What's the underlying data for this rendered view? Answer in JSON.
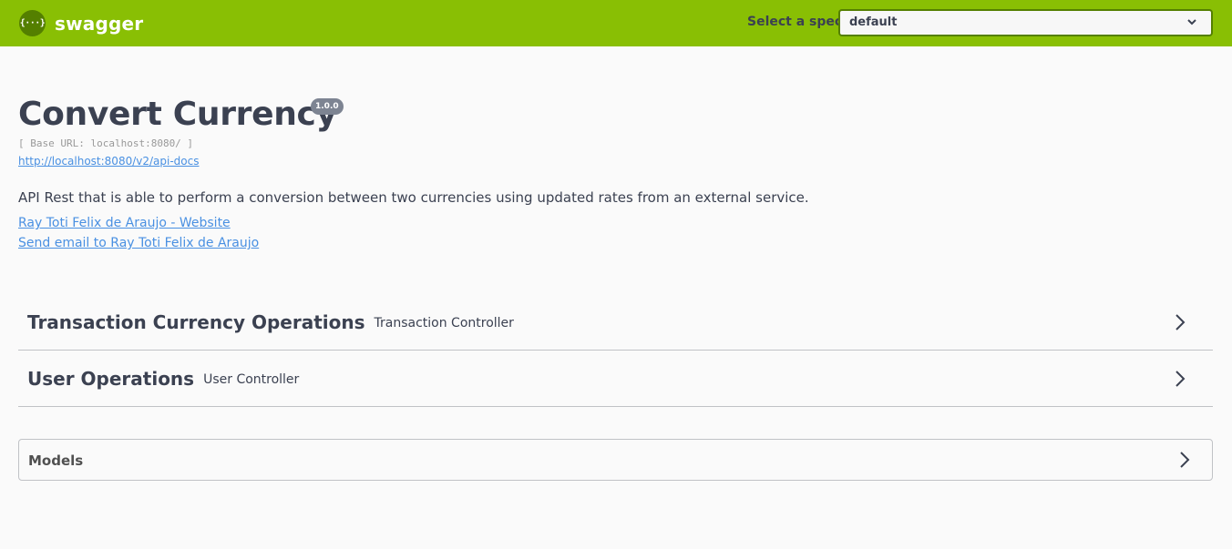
{
  "topbar": {
    "logo_icon": "{···}",
    "logo_text": "swagger",
    "spec_label": "Select a spec",
    "spec_value": "default"
  },
  "info": {
    "title": "Convert Currency",
    "version": "1.0.0",
    "base_url": "[ Base URL: localhost:8080/ ]",
    "api_docs_link": "http://localhost:8080/v2/api-docs",
    "description": "API Rest that is able to perform a conversion between two currencies using updated rates from an external service.",
    "website_link": "Ray Toti Felix de Araujo - Website",
    "email_link": "Send email to Ray Toti Felix de Araujo"
  },
  "tags": [
    {
      "name": "Transaction Currency Operations",
      "description": "Transaction Controller"
    },
    {
      "name": "User Operations",
      "description": "User Controller"
    }
  ],
  "models": {
    "label": "Models"
  },
  "colors": {
    "topbar_bg": "#89bf04",
    "link": "#4990e2",
    "text": "#3b4151",
    "version_badge": "#7d8492"
  },
  "icons": {
    "logo": "swagger-logo-icon",
    "select_chevron": "chevron-down-icon",
    "expand": "chevron-right-icon"
  }
}
